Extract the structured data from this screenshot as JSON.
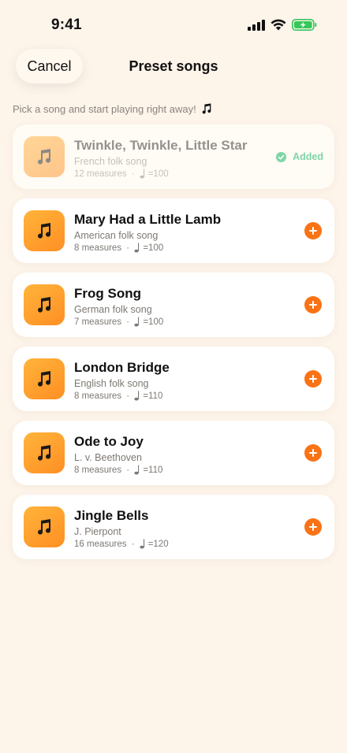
{
  "status": {
    "time": "9:41"
  },
  "header": {
    "cancel_label": "Cancel",
    "title": "Preset songs"
  },
  "subtitle": "Pick a song and start playing right away!",
  "added_label": "Added",
  "colors": {
    "accent": "#f97316",
    "thumb": "#ff9f2e",
    "added": "#7fd6a8",
    "background": "#fdf4ea"
  },
  "songs": [
    {
      "title": "Twinkle, Twinkle, Little Star",
      "origin": "French folk song",
      "measures": "12 measures",
      "tempo": "=100",
      "added": true
    },
    {
      "title": "Mary Had a Little Lamb",
      "origin": "American folk song",
      "measures": "8 measures",
      "tempo": "=100",
      "added": false
    },
    {
      "title": "Frog Song",
      "origin": "German folk song",
      "measures": "7 measures",
      "tempo": "=100",
      "added": false
    },
    {
      "title": "London Bridge",
      "origin": "English folk song",
      "measures": "8 measures",
      "tempo": "=110",
      "added": false
    },
    {
      "title": "Ode to Joy",
      "origin": "L. v. Beethoven",
      "measures": "8 measures",
      "tempo": "=110",
      "added": false
    },
    {
      "title": "Jingle Bells",
      "origin": "J. Pierpont",
      "measures": "16 measures",
      "tempo": "=120",
      "added": false
    }
  ]
}
